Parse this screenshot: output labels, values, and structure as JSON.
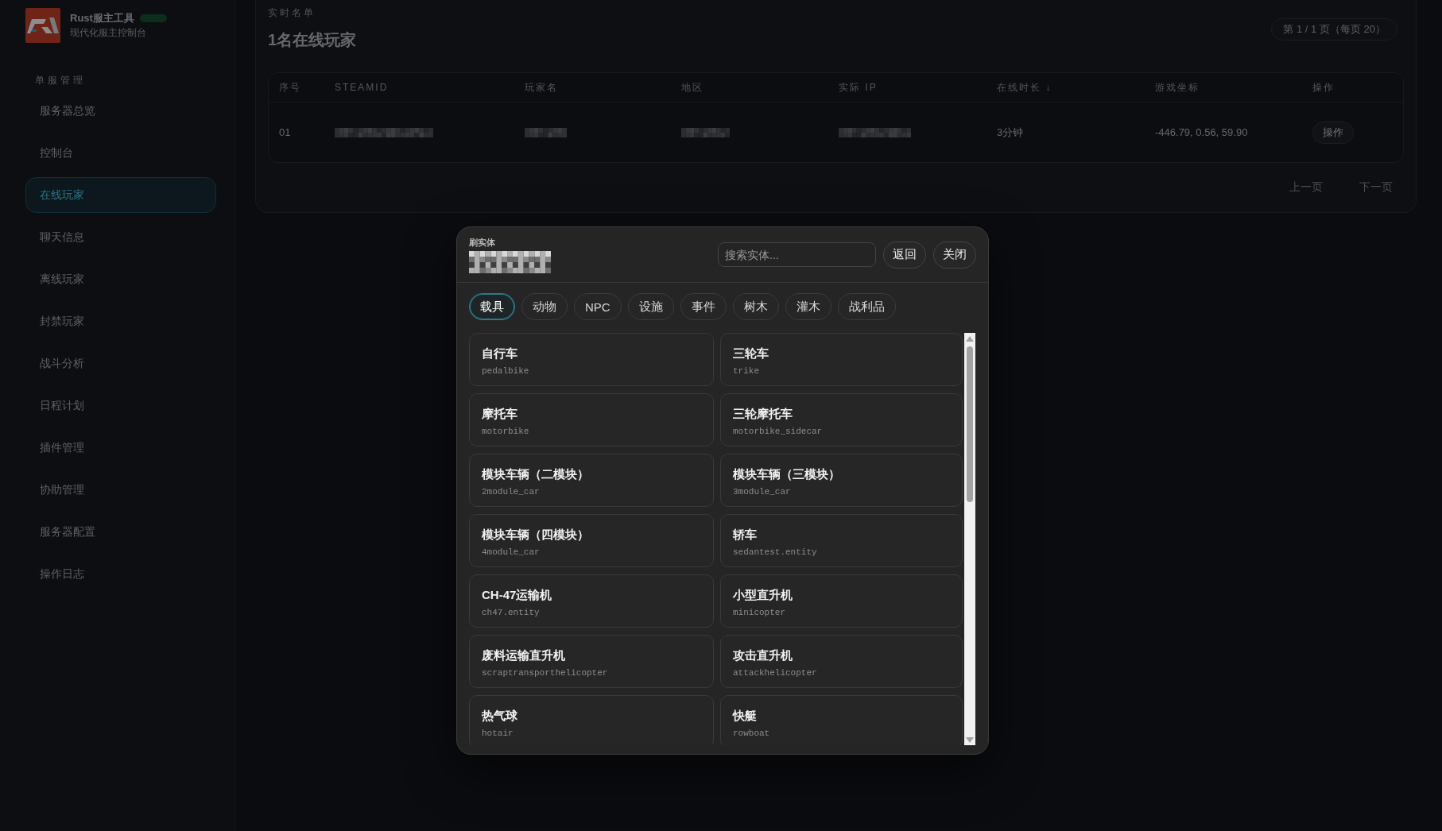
{
  "sidebar": {
    "brand": {
      "title": "Rust服主工具",
      "subtitle": "现代化服主控制台"
    },
    "section_label": "单服管理",
    "items": [
      {
        "label": "服务器总览",
        "selected": false
      },
      {
        "label": "控制台",
        "selected": false
      },
      {
        "label": "在线玩家",
        "selected": true
      },
      {
        "label": "聊天信息",
        "selected": false
      },
      {
        "label": "离线玩家",
        "selected": false
      },
      {
        "label": "封禁玩家",
        "selected": false
      },
      {
        "label": "战斗分析",
        "selected": false
      },
      {
        "label": "日程计划",
        "selected": false
      },
      {
        "label": "插件管理",
        "selected": false
      },
      {
        "label": "协助管理",
        "selected": false
      },
      {
        "label": "服务器配置",
        "selected": false
      },
      {
        "label": "操作日志",
        "selected": false
      }
    ]
  },
  "roster": {
    "eyebrow": "实时名单",
    "heading": "1名在线玩家",
    "page_info": "第 1 / 1 页（每页 20）",
    "table": {
      "columns": [
        {
          "label": "序号"
        },
        {
          "label": "STEAMID"
        },
        {
          "label": "玩家名"
        },
        {
          "label": "地区"
        },
        {
          "label": "实际 IP"
        },
        {
          "label": "在线时长 ↓"
        },
        {
          "label": "游戏坐标"
        },
        {
          "label": "操作"
        }
      ],
      "rows": [
        {
          "cells": [
            {
              "kind": "text",
              "text": "01"
            },
            {
              "kind": "redacted"
            },
            {
              "kind": "redacted"
            },
            {
              "kind": "redacted"
            },
            {
              "kind": "redacted"
            },
            {
              "kind": "text",
              "text": "3分钟"
            },
            {
              "kind": "text",
              "text": "-446.79, 0.56, 59.90"
            },
            {
              "kind": "button",
              "text": "操作"
            }
          ]
        }
      ]
    },
    "pagination": [
      {
        "label": "上一页",
        "disabled": true
      },
      {
        "label": "下一页",
        "disabled": true
      }
    ]
  },
  "modal": {
    "eyebrow": "刷实体",
    "search": {
      "placeholder": "搜索实体..."
    },
    "buttons": [
      "返回",
      "关闭"
    ],
    "tabs": [
      {
        "label": "载具",
        "selected": true
      },
      {
        "label": "动物",
        "selected": false
      },
      {
        "label": "NPC",
        "selected": false
      },
      {
        "label": "设施",
        "selected": false
      },
      {
        "label": "事件",
        "selected": false
      },
      {
        "label": "树木",
        "selected": false
      },
      {
        "label": "灌木",
        "selected": false
      },
      {
        "label": "战利品",
        "selected": false
      }
    ],
    "entities": [
      {
        "name": "自行车",
        "code": "pedalbike"
      },
      {
        "name": "三轮车",
        "code": "trike"
      },
      {
        "name": "摩托车",
        "code": "motorbike"
      },
      {
        "name": "三轮摩托车",
        "code": "motorbike_sidecar"
      },
      {
        "name": "模块车辆（二模块）",
        "code": "2module_car"
      },
      {
        "name": "模块车辆（三模块）",
        "code": "3module_car"
      },
      {
        "name": "模块车辆（四模块）",
        "code": "4module_car"
      },
      {
        "name": "轿车",
        "code": "sedantest.entity"
      },
      {
        "name": "CH-47运输机",
        "code": "ch47.entity"
      },
      {
        "name": "小型直升机",
        "code": "minicopter"
      },
      {
        "name": "废料运输直升机",
        "code": "scraptransporthelicopter"
      },
      {
        "name": "攻击直升机",
        "code": "attackhelicopter"
      },
      {
        "name": "热气球",
        "code": "hotair"
      },
      {
        "name": "快艇",
        "code": "rowboat"
      }
    ]
  }
}
